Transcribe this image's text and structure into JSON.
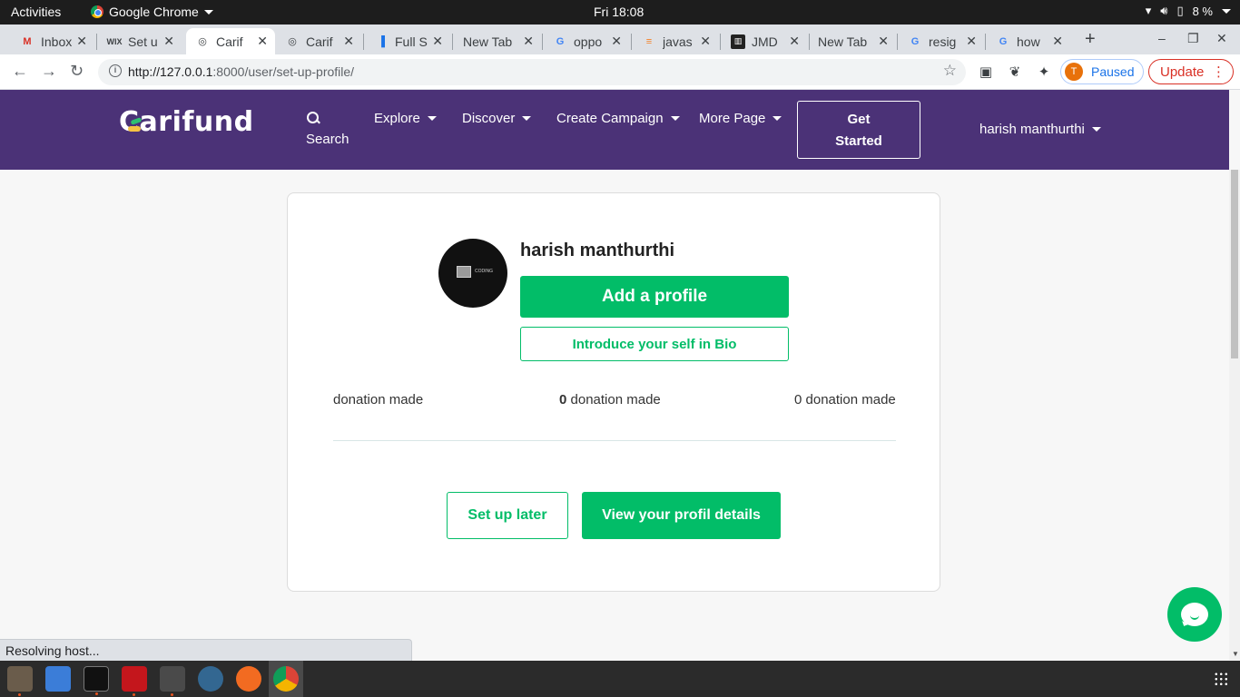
{
  "os_bar": {
    "activities": "Activities",
    "app_name": "Google Chrome",
    "clock": "Fri 18:08",
    "battery": "8 %"
  },
  "tabs": [
    {
      "label": "Inbox",
      "icon": "gmail-icon",
      "active": false
    },
    {
      "label": "Set u",
      "icon": "wix-icon",
      "active": false
    },
    {
      "label": "Carif",
      "icon": "globe-icon",
      "active": true
    },
    {
      "label": "Carif",
      "icon": "globe-icon",
      "active": false
    },
    {
      "label": "Full S",
      "icon": "chart-icon",
      "active": false
    },
    {
      "label": "New Tab",
      "icon": "",
      "active": false
    },
    {
      "label": "oppo",
      "icon": "google-icon",
      "active": false
    },
    {
      "label": "javas",
      "icon": "stackoverflow-icon",
      "active": false
    },
    {
      "label": "JMD",
      "icon": "trello-icon",
      "active": false
    },
    {
      "label": "New Tab",
      "icon": "",
      "active": false
    },
    {
      "label": "resig",
      "icon": "google-icon",
      "active": false
    },
    {
      "label": "how",
      "icon": "google-icon",
      "active": false
    }
  ],
  "browser": {
    "url_host": "http://127.0.0.1",
    "url_rest": ":8000/user/set-up-profile/",
    "profile_initial": "T",
    "paused_label": "Paused",
    "update_label": "Update",
    "status_text": "Resolving host..."
  },
  "site": {
    "logo_text": "arifund",
    "logo_first": "C",
    "search_label": "Search",
    "nav": [
      {
        "label": "Explore"
      },
      {
        "label": "Discover"
      },
      {
        "label": "Create Campaign"
      },
      {
        "label": "More Page"
      }
    ],
    "get_started": "Get Started",
    "get_started_line1": "Get",
    "get_started_line2": "Started",
    "user_name": "harish manthurthi"
  },
  "profile": {
    "name": "harish manthurthi",
    "avatar_text": "CODING",
    "add_profile": "Add a profile",
    "bio": "Introduce your self in Bio",
    "stats": [
      {
        "count": "",
        "label": "donation made"
      },
      {
        "count": "0",
        "label": " donation made"
      },
      {
        "count": "0",
        "label": " donation made"
      }
    ],
    "setup_later": "Set up later",
    "view_details": "View your profil details"
  },
  "colors": {
    "nav_bg": "#4b3277",
    "accent_green": "#02bd68"
  }
}
